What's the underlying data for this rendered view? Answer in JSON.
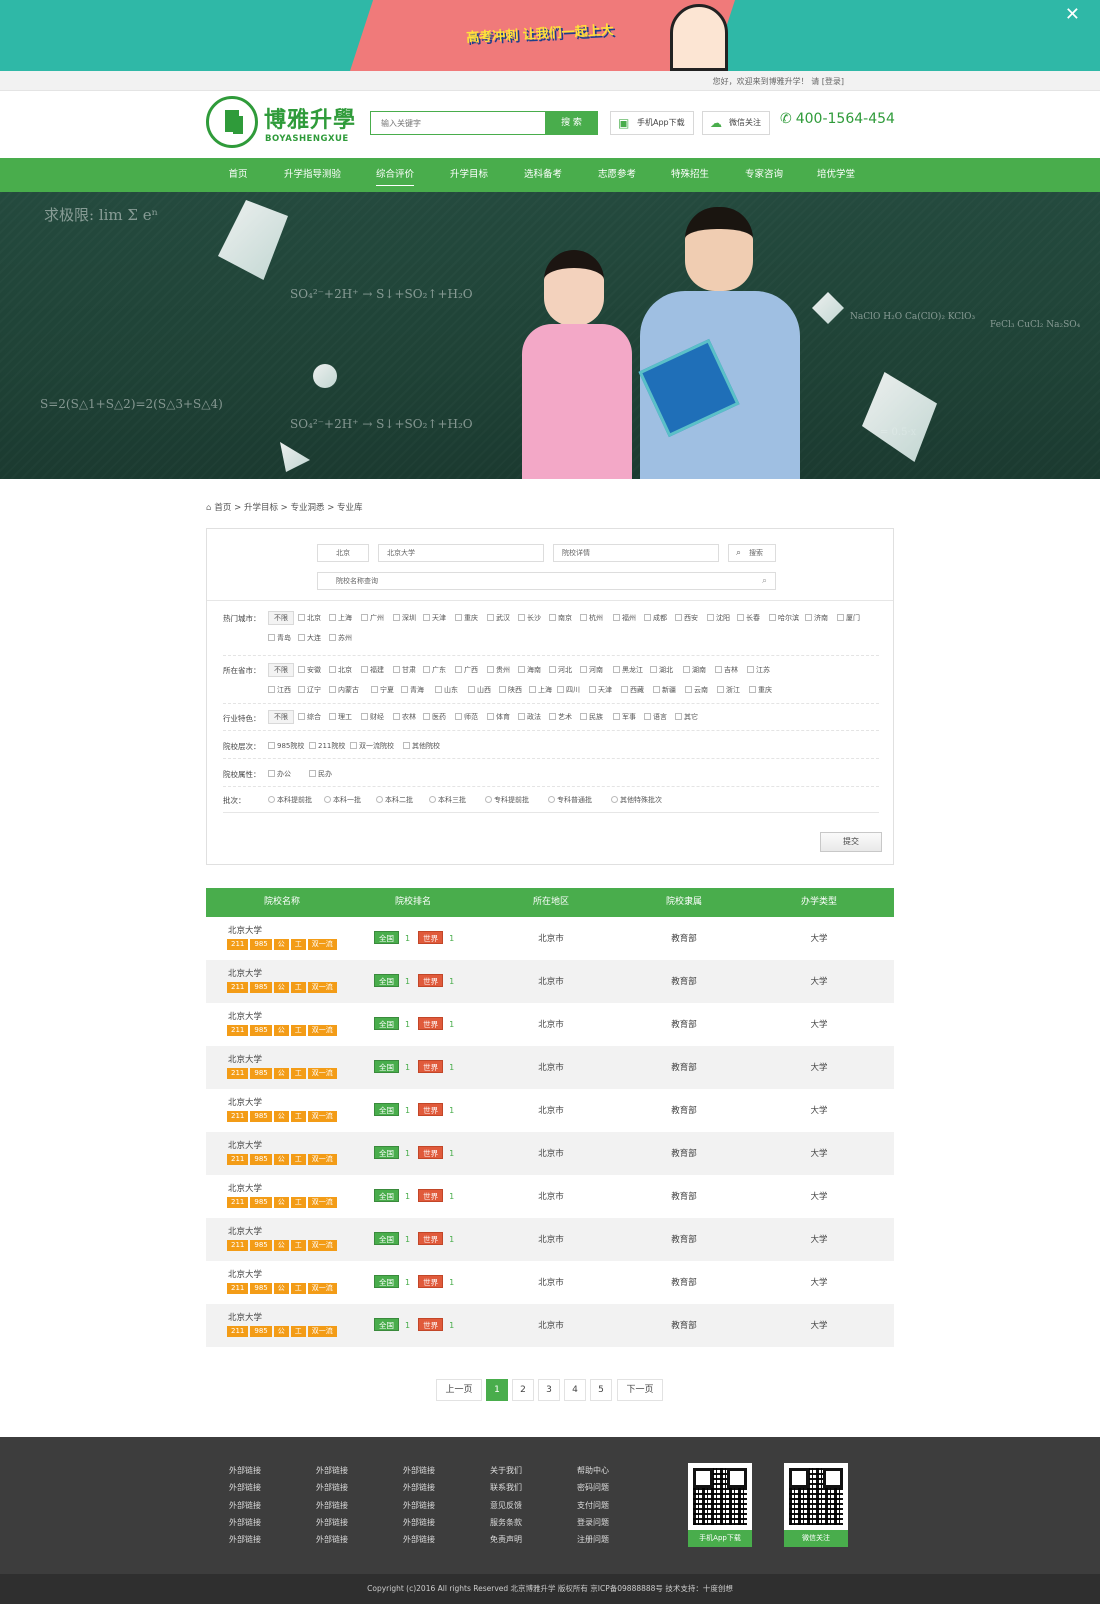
{
  "top_banner": {
    "slogan": "高考冲刺 让我们一起上大学吧",
    "close_icon": "close-icon"
  },
  "welcome": {
    "text": "您好，欢迎来到博雅升学！ 请 [登录]"
  },
  "header": {
    "logo_cn": "博雅升學",
    "logo_en": "BOYASHENGXUE",
    "search_placeholder": "输入关键字",
    "search_button": "搜 索",
    "app_button": "手机App下载",
    "wechat_button": "微信关注",
    "phone": "400-1564-454"
  },
  "nav": {
    "items": [
      "首页",
      "升学指导测验",
      "综合评价",
      "升学目标",
      "选科备考",
      "志愿参考",
      "特殊招生",
      "专家咨询",
      "培优学堂"
    ],
    "active": "综合评价"
  },
  "breadcrumb": {
    "home": "首页",
    "items": [
      "升学目标",
      "专业洞悉",
      "专业库"
    ],
    "sep": ">"
  },
  "filter": {
    "search": {
      "city": "北京",
      "university": "北京大学",
      "detail": "院校详情",
      "search_button": "搜索",
      "school_query_placeholder": "院校名称查询"
    },
    "hot_city": {
      "label": "热门城市：",
      "none": "不限",
      "options": [
        "北京",
        "上海",
        "广州",
        "深圳",
        "天津",
        "重庆",
        "武汉",
        "长沙",
        "南京",
        "杭州",
        "福州",
        "成都",
        "西安",
        "沈阳",
        "长春",
        "哈尔滨",
        "济南",
        "厦门",
        "青岛",
        "大连",
        "苏州"
      ]
    },
    "province": {
      "label": "所在省市：",
      "none": "不限",
      "options": [
        "安徽",
        "北京",
        "福建",
        "甘肃",
        "广东",
        "广西",
        "贵州",
        "海南",
        "河北",
        "河南",
        "黑龙江",
        "湖北",
        "湖南",
        "吉林",
        "江苏",
        "江西",
        "辽宁",
        "内蒙古",
        "宁夏",
        "青海",
        "山东",
        "山西",
        "陕西",
        "上海",
        "四川",
        "天津",
        "西藏",
        "新疆",
        "云南",
        "浙江",
        "重庆"
      ]
    },
    "industry": {
      "label": "行业特色：",
      "none": "不限",
      "options": [
        "综合",
        "理工",
        "财经",
        "农林",
        "医药",
        "师范",
        "体育",
        "政法",
        "艺术",
        "民族",
        "军事",
        "语言",
        "其它"
      ]
    },
    "level": {
      "label": "院校层次：",
      "options": [
        "985院校",
        "211院校",
        "双一流院校",
        "其他院校"
      ]
    },
    "attr": {
      "label": "院校属性：",
      "options": [
        "办公",
        "民办"
      ]
    },
    "batch": {
      "label": "批次：",
      "options": [
        "本科提前批",
        "本科一批",
        "本科二批",
        "本科三批",
        "专科提前批",
        "专科普通批",
        "其他特殊批次"
      ]
    },
    "submit": "提交"
  },
  "table": {
    "headers": [
      "院校名称",
      "院校排名",
      "所在地区",
      "院校隶属",
      "办学类型"
    ],
    "rows": [
      {
        "name": "北京大学",
        "tags": [
          "211",
          "985",
          "公",
          "工",
          "双一流"
        ],
        "rank_cn_label": "全国",
        "rank_cn": "1",
        "rank_world_label": "世界",
        "rank_world": "1",
        "region": "北京市",
        "affiliation": "教育部",
        "type": "大学"
      },
      {
        "name": "北京大学",
        "tags": [
          "211",
          "985",
          "公",
          "工",
          "双一流"
        ],
        "rank_cn_label": "全国",
        "rank_cn": "1",
        "rank_world_label": "世界",
        "rank_world": "1",
        "region": "北京市",
        "affiliation": "教育部",
        "type": "大学"
      },
      {
        "name": "北京大学",
        "tags": [
          "211",
          "985",
          "公",
          "工",
          "双一流"
        ],
        "rank_cn_label": "全国",
        "rank_cn": "1",
        "rank_world_label": "世界",
        "rank_world": "1",
        "region": "北京市",
        "affiliation": "教育部",
        "type": "大学"
      },
      {
        "name": "北京大学",
        "tags": [
          "211",
          "985",
          "公",
          "工",
          "双一流"
        ],
        "rank_cn_label": "全国",
        "rank_cn": "1",
        "rank_world_label": "世界",
        "rank_world": "1",
        "region": "北京市",
        "affiliation": "教育部",
        "type": "大学"
      },
      {
        "name": "北京大学",
        "tags": [
          "211",
          "985",
          "公",
          "工",
          "双一流"
        ],
        "rank_cn_label": "全国",
        "rank_cn": "1",
        "rank_world_label": "世界",
        "rank_world": "1",
        "region": "北京市",
        "affiliation": "教育部",
        "type": "大学"
      },
      {
        "name": "北京大学",
        "tags": [
          "211",
          "985",
          "公",
          "工",
          "双一流"
        ],
        "rank_cn_label": "全国",
        "rank_cn": "1",
        "rank_world_label": "世界",
        "rank_world": "1",
        "region": "北京市",
        "affiliation": "教育部",
        "type": "大学"
      },
      {
        "name": "北京大学",
        "tags": [
          "211",
          "985",
          "公",
          "工",
          "双一流"
        ],
        "rank_cn_label": "全国",
        "rank_cn": "1",
        "rank_world_label": "世界",
        "rank_world": "1",
        "region": "北京市",
        "affiliation": "教育部",
        "type": "大学"
      },
      {
        "name": "北京大学",
        "tags": [
          "211",
          "985",
          "公",
          "工",
          "双一流"
        ],
        "rank_cn_label": "全国",
        "rank_cn": "1",
        "rank_world_label": "世界",
        "rank_world": "1",
        "region": "北京市",
        "affiliation": "教育部",
        "type": "大学"
      },
      {
        "name": "北京大学",
        "tags": [
          "211",
          "985",
          "公",
          "工",
          "双一流"
        ],
        "rank_cn_label": "全国",
        "rank_cn": "1",
        "rank_world_label": "世界",
        "rank_world": "1",
        "region": "北京市",
        "affiliation": "教育部",
        "type": "大学"
      },
      {
        "name": "北京大学",
        "tags": [
          "211",
          "985",
          "公",
          "工",
          "双一流"
        ],
        "rank_cn_label": "全国",
        "rank_cn": "1",
        "rank_world_label": "世界",
        "rank_world": "1",
        "region": "北京市",
        "affiliation": "教育部",
        "type": "大学"
      }
    ]
  },
  "pager": {
    "prev": "上一页",
    "pages": [
      "1",
      "2",
      "3",
      "4",
      "5"
    ],
    "current": "1",
    "next": "下一页"
  },
  "footer": {
    "columns": [
      [
        "外部链接",
        "外部链接",
        "外部链接",
        "外部链接",
        "外部链接"
      ],
      [
        "外部链接",
        "外部链接",
        "外部链接",
        "外部链接",
        "外部链接"
      ],
      [
        "外部链接",
        "外部链接",
        "外部链接",
        "外部链接",
        "外部链接"
      ],
      [
        "关于我们",
        "联系我们",
        "意见反馈",
        "服务条款",
        "免责声明"
      ],
      [
        "帮助中心",
        "密码问题",
        "支付问题",
        "登录问题",
        "注册问题"
      ]
    ],
    "qr_app": "手机App下载",
    "qr_wechat": "微信关注"
  },
  "copyright": "Copyright (c)2016 All rights Reserved    北京博雅升学    版权所有    京ICP备09888888号    技术支持：十度创想",
  "colors": {
    "brand_green": "#49ad4c",
    "tag_orange": "#f39c17",
    "world_red": "#e05a3b",
    "footer_bg": "#3d3d3d"
  }
}
